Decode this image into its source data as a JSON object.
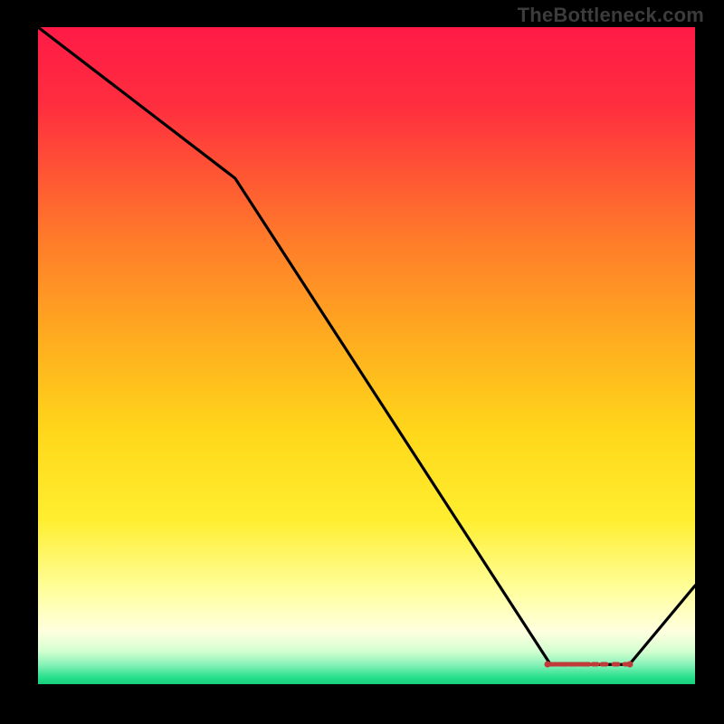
{
  "watermark": "TheBottleneck.com",
  "chart_data": {
    "type": "line",
    "title": "",
    "xlabel": "",
    "ylabel": "",
    "xlim": [
      0,
      100
    ],
    "ylim": [
      0,
      100
    ],
    "x": [
      0,
      30,
      78,
      90,
      100
    ],
    "values": [
      100,
      77,
      3,
      3,
      15
    ],
    "marker_region_x": [
      78,
      90
    ],
    "marker_region_y": 3
  },
  "colors": {
    "gradient_top": "#ff1a46",
    "gradient_mid1": "#ff9a1a",
    "gradient_mid2": "#ffe81a",
    "gradient_low": "#ffffc0",
    "gradient_bottom": "#25e08a",
    "line": "#000000",
    "marker": "#c13a3a"
  }
}
